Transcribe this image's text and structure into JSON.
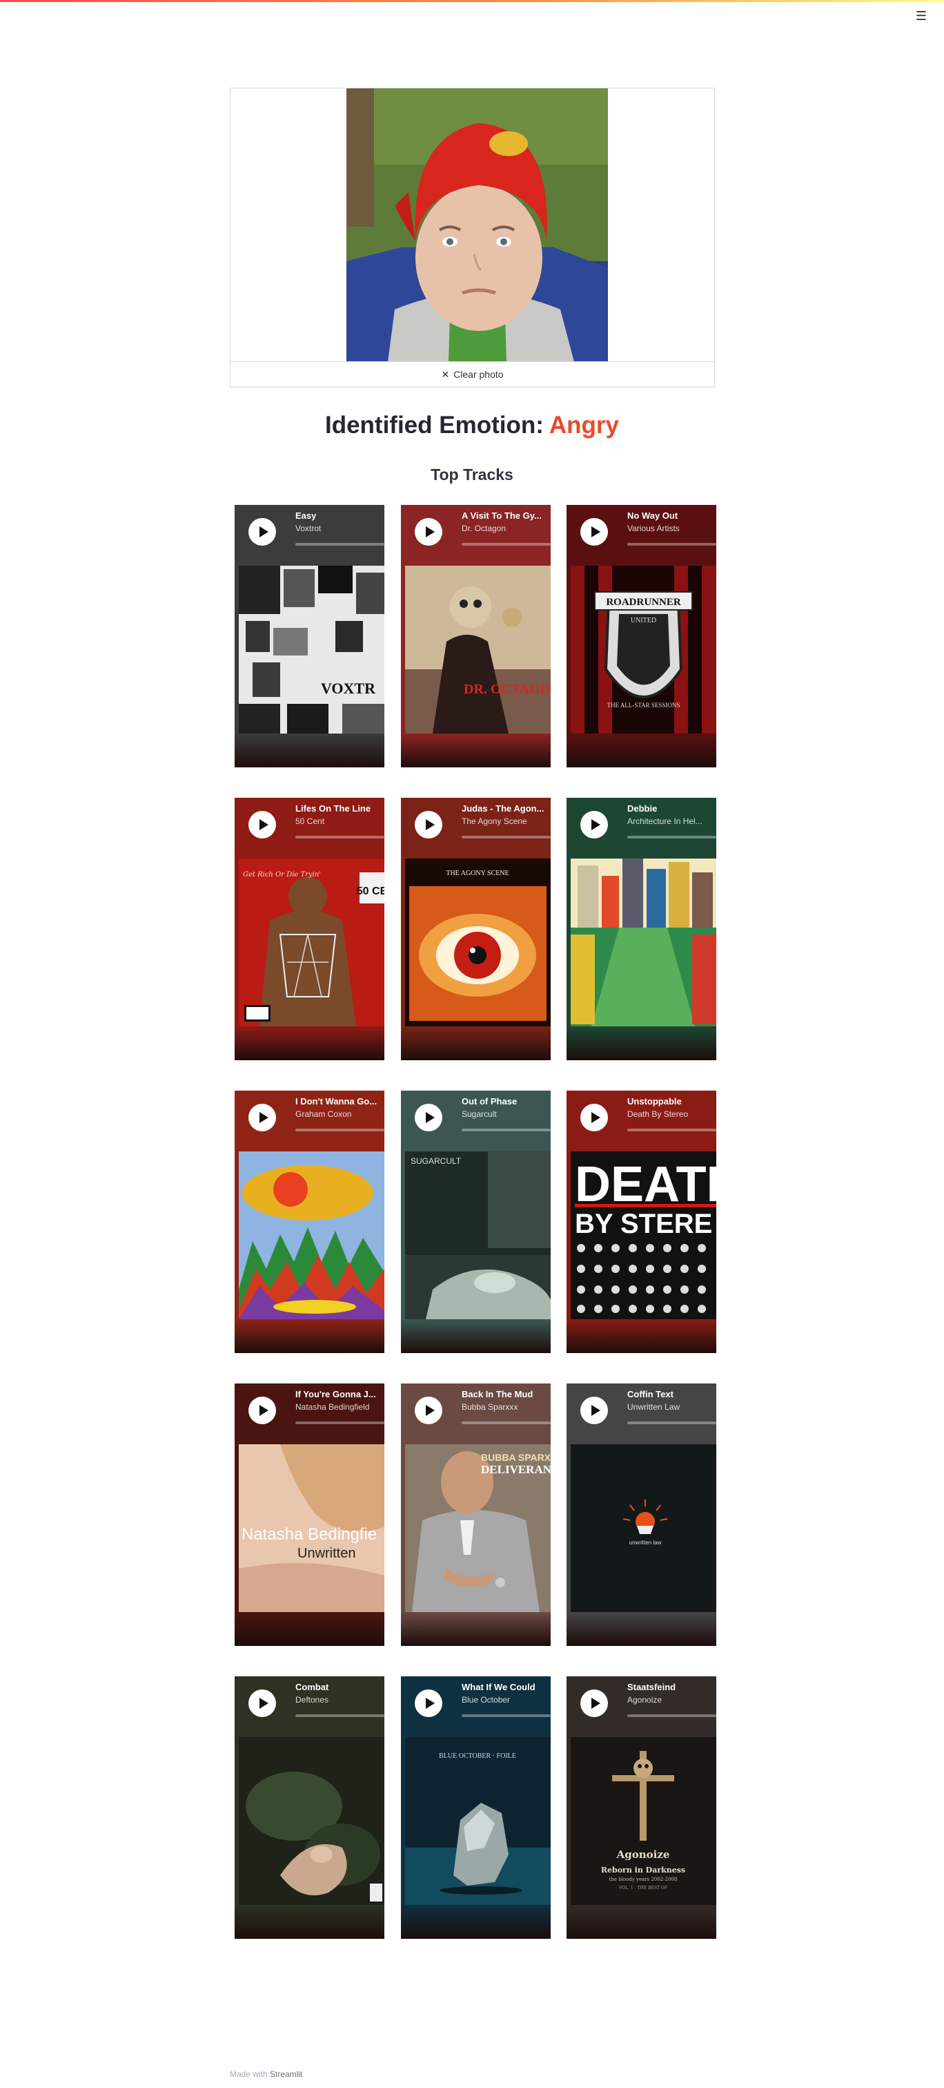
{
  "header": {
    "menu_icon": "hamburger-menu-icon",
    "menu_glyph": "☰",
    "stripe_colors": [
      "#ff4b4b",
      "#ff8a3d",
      "#fffd80"
    ]
  },
  "camera": {
    "clear_label": "Clear photo",
    "clear_icon": "close-icon",
    "clear_glyph": "✕"
  },
  "result": {
    "label": "Identified Emotion:",
    "emotion": "Angry",
    "emotion_color": "#e84b2a"
  },
  "tracks": {
    "heading": "Top Tracks",
    "items": [
      {
        "title": "Easy",
        "artist": "Voxtrot",
        "color": "#3c3c3c"
      },
      {
        "title": "A Visit To The Gy...",
        "artist": "Dr. Octagon",
        "color": "#8b2424"
      },
      {
        "title": "No Way Out",
        "artist": "Various Artists",
        "color": "#5a1010"
      },
      {
        "title": "Lifes On The Line",
        "artist": "50 Cent",
        "color": "#8e1b14"
      },
      {
        "title": "Judas - The Agon...",
        "artist": "The Agony Scene",
        "color": "#7a2316"
      },
      {
        "title": "Debbie",
        "artist": "Architecture In Hel...",
        "color": "#1d4733"
      },
      {
        "title": "I Don't Wanna Go...",
        "artist": "Graham Coxon",
        "color": "#8f2416"
      },
      {
        "title": "Out of Phase",
        "artist": "Sugarcult",
        "color": "#3c5752"
      },
      {
        "title": "Unstoppable",
        "artist": "Death By Stereo",
        "color": "#8b1c15"
      },
      {
        "title": "If You're Gonna J...",
        "artist": "Natasha Bedingfield",
        "color": "#4a1410"
      },
      {
        "title": "Back In The Mud",
        "artist": "Bubba Sparxxx",
        "color": "#6b4a44"
      },
      {
        "title": "Coffin Text",
        "artist": "Unwritten Law",
        "color": "#454545"
      },
      {
        "title": "Combat",
        "artist": "Deftones",
        "color": "#2d3224"
      },
      {
        "title": "What If We Could",
        "artist": "Blue October",
        "color": "#0f3041"
      },
      {
        "title": "Staatsfeind",
        "artist": "Agonoize",
        "color": "#332b27"
      }
    ]
  },
  "art_text": {
    "voxtrot": "VOXTR",
    "dr_octagon": "DR. OCTAGO",
    "roadrunner_top": "ROADRUNNER",
    "roadrunner_sub": "UNITED",
    "roadrunner_bottom": "THE ALL-STAR SESSIONS",
    "fifty_badge": "50 CE",
    "fifty_script": "Get Rich Or Die Tryin'",
    "agony": "THE AGONY SCENE",
    "sugarcult": "SUGARCULT",
    "dbs_line1": "DEATH",
    "dbs_line2": "BY STERE",
    "natasha_line1": "Natasha Bedingfie",
    "natasha_line2": "Unwritten",
    "bubba_line1": "BUBBA SPARX",
    "bubba_line2": "DELIVERAN",
    "unwritten": "unwritten law",
    "blue_october": "BLUE OCTOBER · FOILE",
    "agonoize_name": "Agonoize",
    "agonoize_line1": "Reborn in Darkness",
    "agonoize_line2": "the bloody years 2002-2008",
    "agonoize_line3": "VOL. 1 - THE BEST OF"
  },
  "footer": {
    "prefix": "Made with",
    "brand": "Streamlit"
  }
}
